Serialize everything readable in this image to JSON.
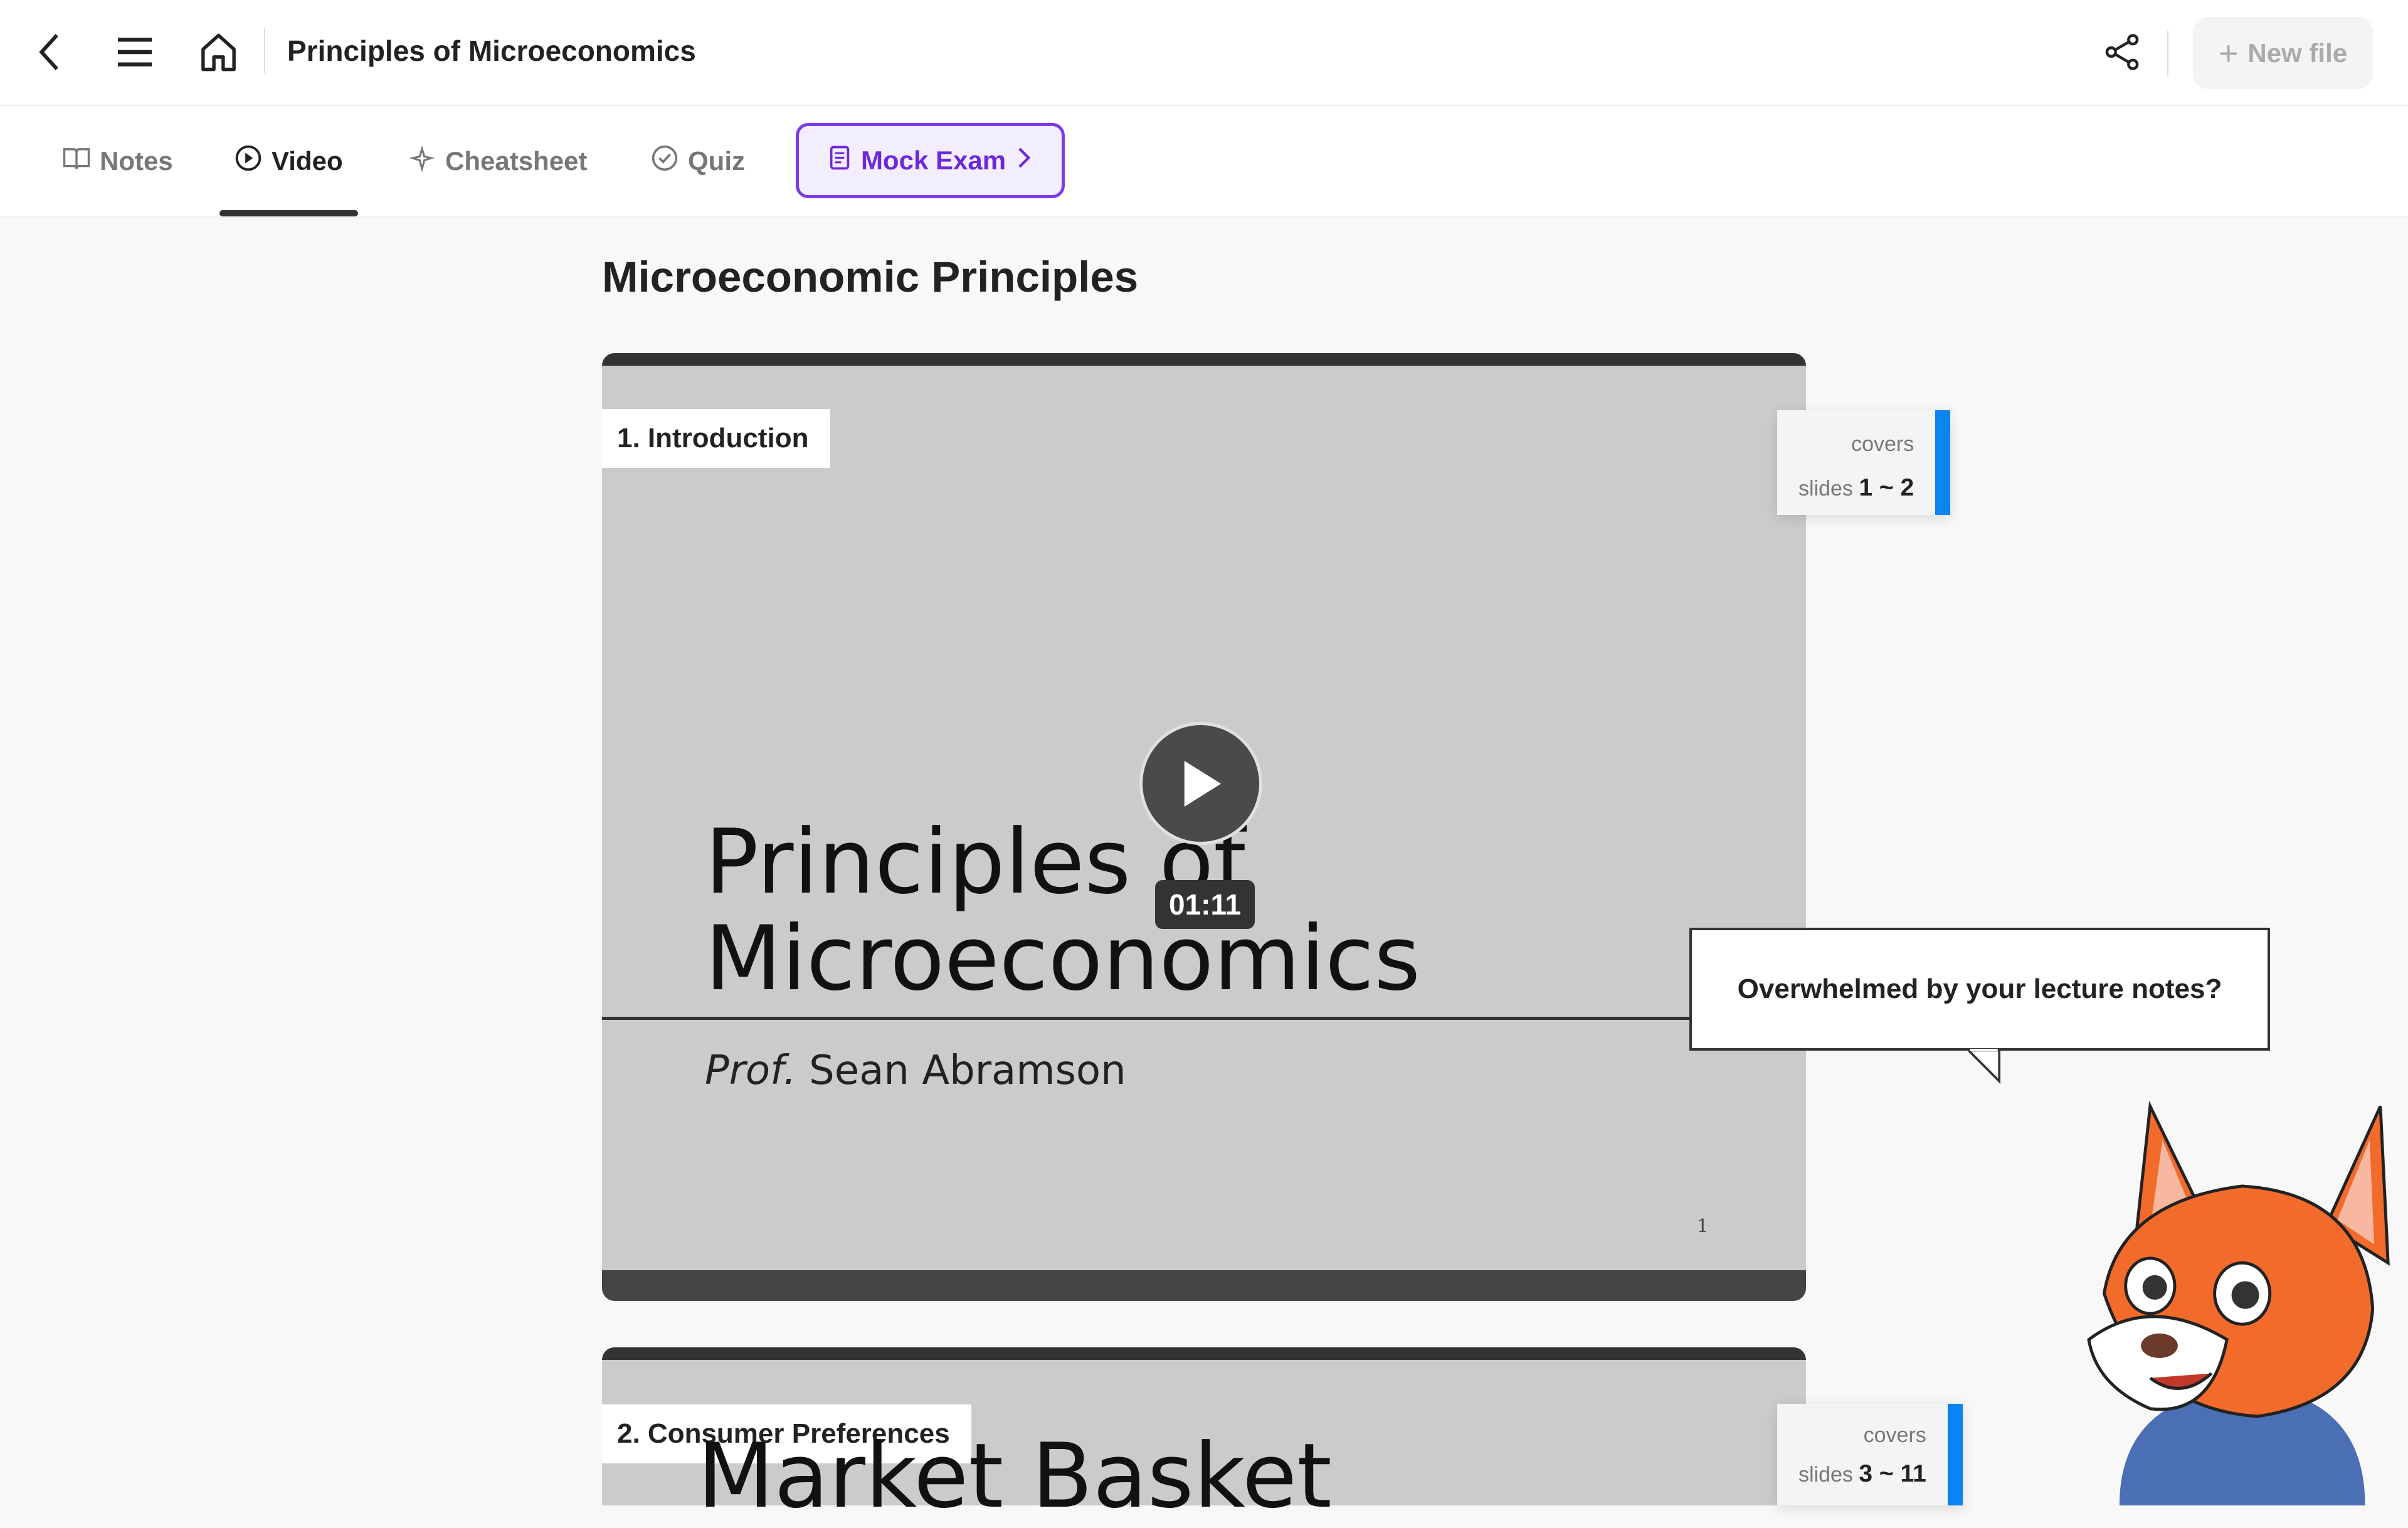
{
  "header": {
    "title": "Principles of Microeconomics",
    "new_file_label": "New file"
  },
  "tabs": [
    {
      "label": "Notes"
    },
    {
      "label": "Video",
      "active": true
    },
    {
      "label": "Cheatsheet"
    },
    {
      "label": "Quiz"
    },
    {
      "label": "Mock Exam"
    }
  ],
  "main": {
    "heading": "Microeconomic Principles",
    "videos": [
      {
        "section": "1. Introduction",
        "covers": "covers",
        "slides_word": "slides",
        "range": "1 ~ 2",
        "slide_title_line1": "Principles of",
        "slide_title_line2": "Microeconomics",
        "author_prefix": "Prof.",
        "author": "Sean Abramson",
        "page_number": "1",
        "duration": "01:11"
      },
      {
        "section": "2. Consumer Preferences",
        "covers": "covers",
        "slides_word": "slides",
        "range": "3 ~ 11",
        "slide_title_line1": "Market Basket"
      }
    ]
  },
  "mascot": {
    "speech": "Overwhelmed by your lecture notes?"
  },
  "colors": {
    "accent_purple": "#7c3aed",
    "covers_bar": "#0a84f0",
    "video_frame": "#333333"
  }
}
